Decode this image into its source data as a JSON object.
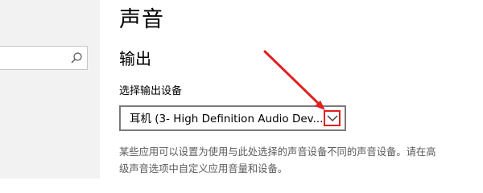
{
  "page": {
    "title": "声音"
  },
  "output": {
    "heading": "输出",
    "device_label": "选择输出设备",
    "selected_device": "耳机 (3- High Definition Audio Device)",
    "description_lines": [
      "某些应用可以设置为使用与此处选择的声音设备不同的声音设备。请在高",
      "级声音选项中自定义应用音量和设备。"
    ]
  },
  "sidebar": {
    "search_value": ""
  },
  "icons": {
    "search": "search-icon",
    "dropdown": "chevron-down-icon"
  },
  "colors": {
    "annotation": "#e02020",
    "description_text": "#5a5a5a",
    "sidebar_bg": "#f2f2f2"
  }
}
